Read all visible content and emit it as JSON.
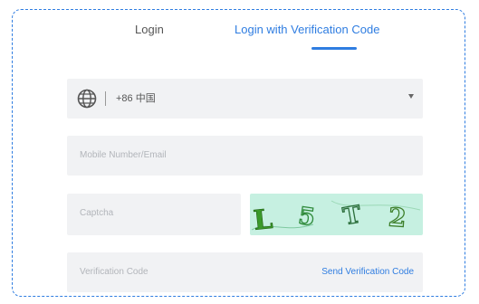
{
  "tabs": {
    "login_label": "Login",
    "code_login_label": "Login with Verification Code",
    "active": "code_login"
  },
  "country_field": {
    "icon": "globe-icon",
    "value": "+86 中国",
    "dropdown_icon": "caret-down-icon"
  },
  "account_field": {
    "placeholder": "Mobile Number/Email"
  },
  "captcha_field": {
    "placeholder": "Captcha",
    "image_text": "L5T2"
  },
  "code_field": {
    "placeholder": "Verification Code",
    "send_label": "Send Verification Code"
  },
  "colors": {
    "accent": "#2f7de1",
    "field_bg": "#f1f2f4",
    "captcha_bg": "#c6f0e1",
    "captcha_glyph": "#3a9a2a"
  }
}
